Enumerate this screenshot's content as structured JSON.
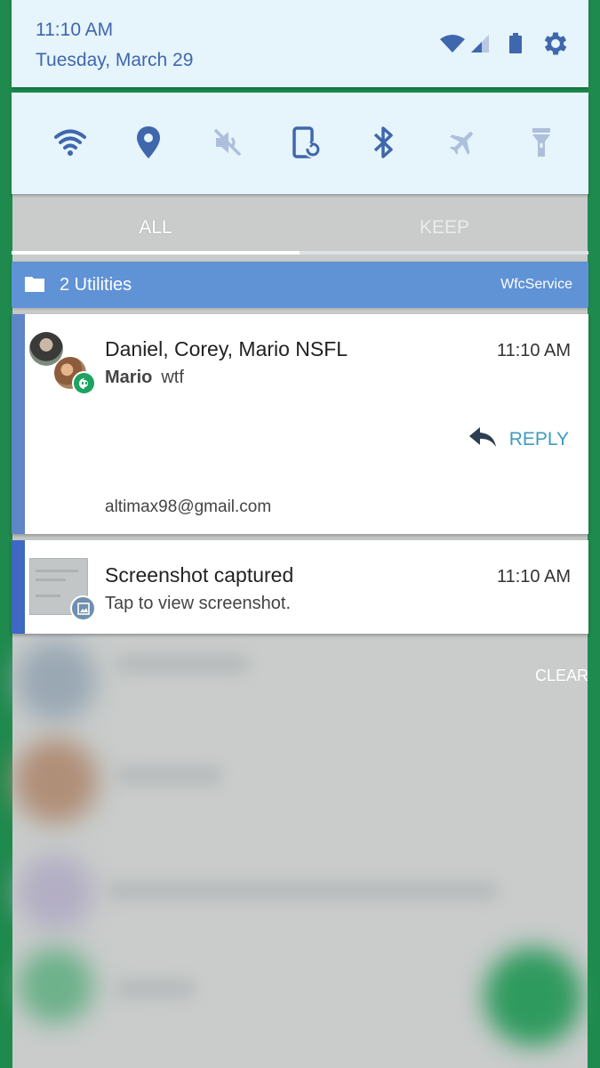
{
  "status_bar": {
    "time": "11:10 AM",
    "date": "Tuesday, March 29",
    "icons": [
      "wifi-signal-icon",
      "cell-signal-icon",
      "battery-icon",
      "settings-gear-icon"
    ]
  },
  "quick_settings": {
    "tiles": [
      {
        "name": "wifi",
        "icon": "wifi-icon",
        "active": true
      },
      {
        "name": "location",
        "icon": "location-pin-icon",
        "active": true
      },
      {
        "name": "sound",
        "icon": "volume-muted-icon",
        "active": false
      },
      {
        "name": "auto-rotate",
        "icon": "rotate-icon",
        "active": true
      },
      {
        "name": "bluetooth",
        "icon": "bluetooth-icon",
        "active": true
      },
      {
        "name": "airplane-mode",
        "icon": "airplane-icon",
        "active": false
      },
      {
        "name": "flashlight",
        "icon": "flashlight-icon",
        "active": false
      }
    ]
  },
  "tabs": [
    {
      "label": "ALL",
      "selected": true
    },
    {
      "label": "KEEP",
      "selected": false
    }
  ],
  "group": {
    "title": "2 Utilities",
    "source": "WfcService",
    "icon": "folder-icon"
  },
  "notifications": [
    {
      "title": "Daniel, Corey, Mario NSFL",
      "time": "11:10 AM",
      "sender": "Mario",
      "message": "wtf",
      "action_label": "REPLY",
      "account": "altimax98@gmail.com",
      "app_icon": "hangouts-icon"
    },
    {
      "title": "Screenshot captured",
      "time": "11:10 AM",
      "message": "Tap to view screenshot.",
      "app_icon": "image-icon"
    }
  ],
  "clear_label": "CLEAR",
  "colors": {
    "accent_blue": "#3f67ad",
    "panel_bg": "#e6f4fb",
    "group_header": "#6092d6",
    "reply_color": "#3f9bbd",
    "hangouts_green": "#1ea362"
  }
}
